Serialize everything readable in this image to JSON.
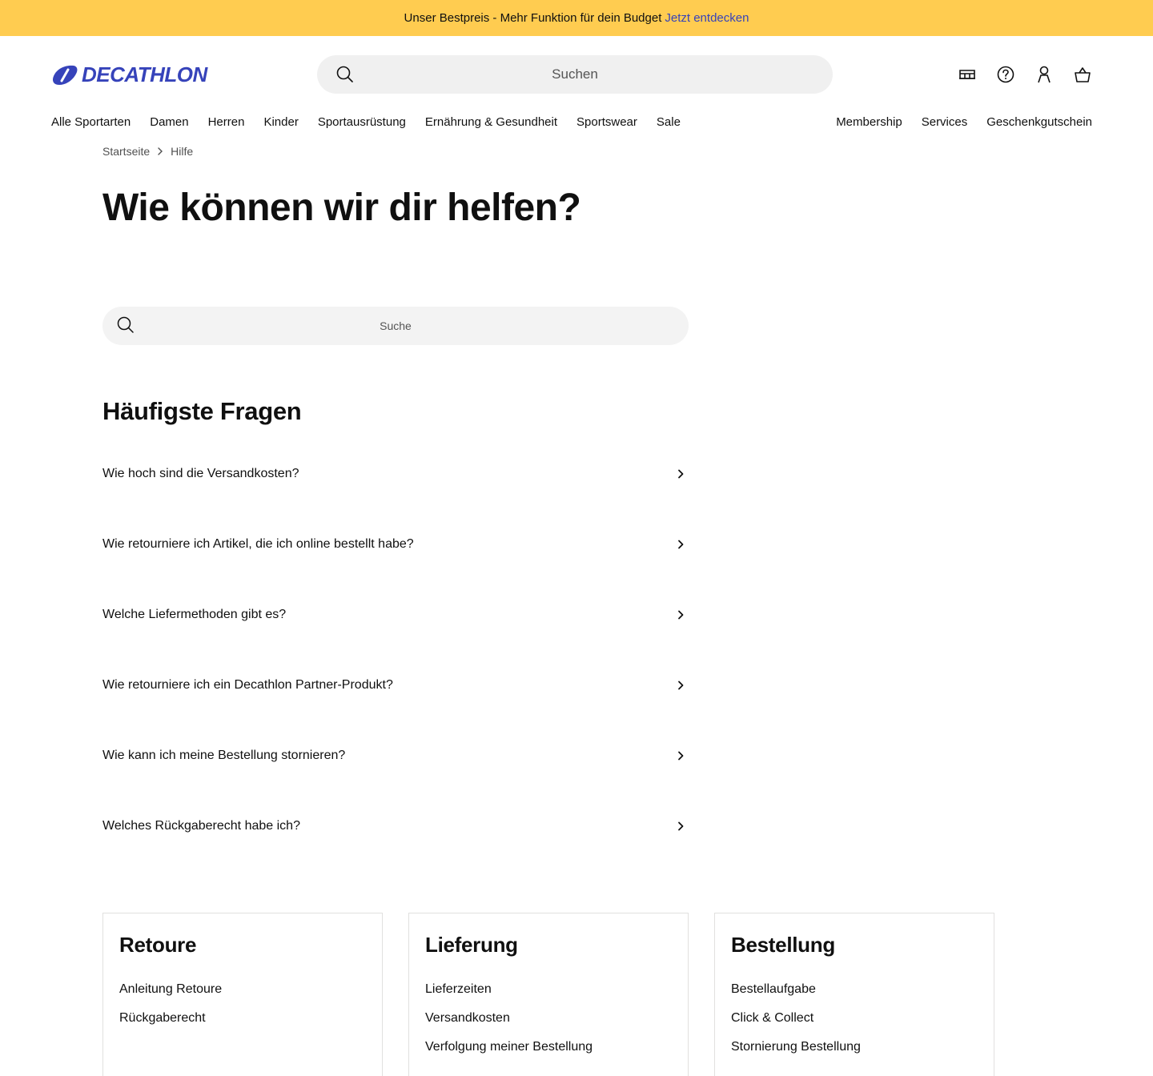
{
  "promo": {
    "text": "Unser Bestpreis - Mehr Funktion für dein Budget",
    "link": "Jetzt entdecken"
  },
  "header": {
    "logo_text": "DECATHLON",
    "search_placeholder": "Suchen",
    "icons": [
      "store-icon",
      "help-icon",
      "account-icon",
      "cart-icon"
    ]
  },
  "nav": {
    "left": [
      "Alle Sportarten",
      "Damen",
      "Herren",
      "Kinder",
      "Sportausrüstung",
      "Ernährung & Gesundheit",
      "Sportswear",
      "Sale"
    ],
    "right": [
      "Membership",
      "Services",
      "Geschenkgutschein"
    ]
  },
  "breadcrumb": {
    "home": "Startseite",
    "current": "Hilfe"
  },
  "page": {
    "title": "Wie können wir dir helfen?",
    "search_placeholder": "Suche"
  },
  "faq": {
    "title": "Häufigste Fragen",
    "items": [
      "Wie hoch sind die Versandkosten?",
      "Wie retourniere ich Artikel, die ich online bestellt habe?",
      "Welche Liefermethoden gibt es?",
      "Wie retourniere ich ein Decathlon Partner-Produkt?",
      "Wie kann ich meine Bestellung stornieren?",
      "Welches Rückgaberecht habe ich?"
    ]
  },
  "cards": [
    {
      "title": "Retoure",
      "links": [
        "Anleitung Retoure",
        "Rückgaberecht"
      ]
    },
    {
      "title": "Lieferung",
      "links": [
        "Lieferzeiten",
        "Versandkosten",
        "Verfolgung meiner Bestellung"
      ]
    },
    {
      "title": "Bestellung",
      "links": [
        "Bestellaufgabe",
        "Click & Collect",
        "Stornierung Bestellung"
      ]
    }
  ],
  "colors": {
    "promo_bg": "#ffcc50",
    "brand": "#3643ba",
    "text": "#101010"
  }
}
